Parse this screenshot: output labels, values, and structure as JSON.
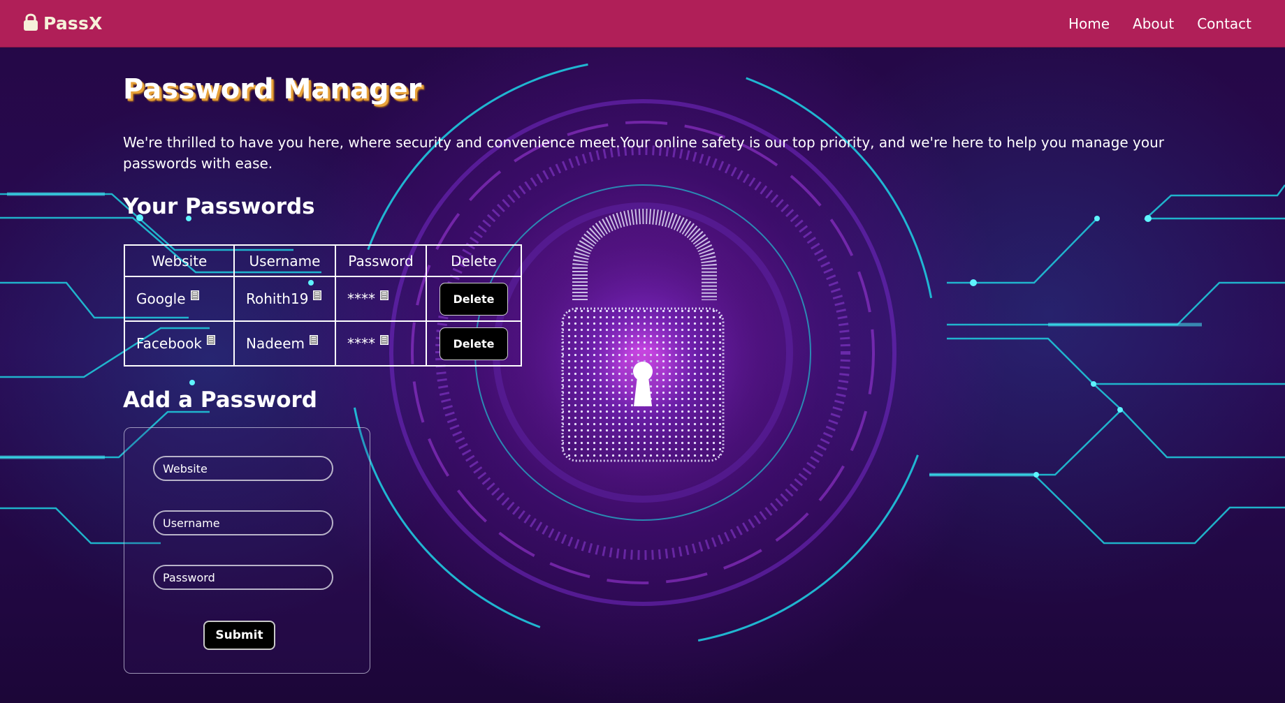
{
  "nav": {
    "brand": "PassX",
    "links": [
      "Home",
      "About",
      "Contact"
    ]
  },
  "main": {
    "title": "Password Manager",
    "intro": "We're thrilled to have you here, where security and convenience meet.Your online safety is our top priority, and we're here to help you manage your passwords with ease.",
    "passwords_heading": "Your Passwords",
    "table": {
      "headers": [
        "Website",
        "Username",
        "Password",
        "Delete"
      ],
      "rows": [
        {
          "website": "Google",
          "username": "Rohith19",
          "password": "****",
          "delete_label": "Delete"
        },
        {
          "website": "Facebook",
          "username": "Nadeem",
          "password": "****",
          "delete_label": "Delete"
        }
      ]
    },
    "add_heading": "Add a Password",
    "form": {
      "website_placeholder": "Website",
      "username_placeholder": "Username",
      "password_placeholder": "Password",
      "submit_label": "Submit"
    }
  },
  "colors": {
    "navbar": "#b01f58",
    "brand_text": "#f6f1d9",
    "title_shadow": "#e8a23a",
    "background": "#240845",
    "circuit": "#1fd0e0"
  },
  "icons": [
    "lock-icon",
    "copy-icon",
    "padlock-illustration"
  ]
}
